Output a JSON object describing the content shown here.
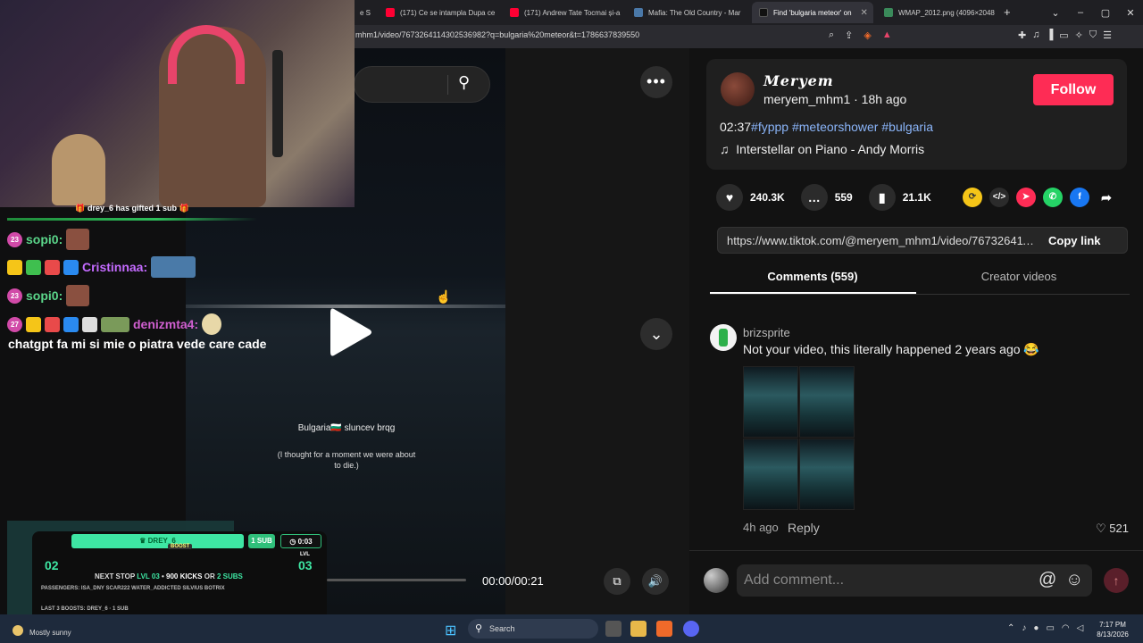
{
  "browser": {
    "tabs": [
      {
        "title": "e So",
        "icon": "tab-icon"
      },
      {
        "title": "(171) Ce se intampla Dupa ce",
        "icon": "youtube-icon"
      },
      {
        "title": "(171) Andrew Tate Tocmai și-a",
        "icon": "youtube-icon"
      },
      {
        "title": "Mafia: The Old Country - Mar",
        "icon": "steam-icon"
      },
      {
        "title": "Find 'bulgaria meteor' on",
        "icon": "tiktok-icon"
      },
      {
        "title": "WMAP_2012.png (4096×2048",
        "icon": "image-icon"
      }
    ],
    "url": "mhm1/video/7673264114302536982?q=bulgaria%20meteor&t=1786637839550",
    "new_tab": "+"
  },
  "video": {
    "search_placeholder": "",
    "caption_title": "Bulgaria🇧🇬 sluncev brqg",
    "caption_sub": "(I thought for a moment we were about to die.)",
    "time": "00:00/00:21",
    "more": "•••",
    "progress": 0
  },
  "stream": {
    "sub_banner": "drey_6 has gifted 1 sub",
    "chat": [
      {
        "badge": "23",
        "user": "sopi0:",
        "color": "#5bd68a"
      },
      {
        "badge": "",
        "user": "Cristinnaa:",
        "color": "#c46bff"
      },
      {
        "badge": "23",
        "user": "sopi0:",
        "color": "#5bd68a"
      },
      {
        "badge": "27",
        "user": "denizmta4:",
        "color": "#d05fd0"
      }
    ],
    "last_message": "chatgpt fa mi si mie o piatra vede care cade",
    "widget": {
      "top_name": "DREY_6",
      "boost": "BOOST",
      "sub_pill": "1 SUB",
      "timer": "0:03",
      "level_left": "02",
      "level_right": "03",
      "lvl_label": "LVL",
      "next_stop_prefix": "NEXT STOP ",
      "next_stop_lvl": "LVL 03",
      "next_stop_mid": " • ",
      "next_kicks": "900 KICKS",
      "next_or": " OR ",
      "next_subs": "2 SUBS",
      "passengers": "PASSENGERS:  ISA_DNY   SCAR222   WATER_ADDICTED   SILVIUS   BOTRIX",
      "last_boosts": "LAST 3 BOOSTS:   DREY_6 · 1 SUB"
    }
  },
  "post": {
    "display_name": "𝑴𝒆𝒓𝒚𝒆𝒎",
    "username_time": "meryem_mhm1 · 18h ago",
    "follow": "Follow",
    "desc_time": "02:37",
    "tags": [
      "#fyppp",
      "#meteorshower",
      "#bulgaria"
    ],
    "music": "Interstellar on Piano - Andy Morris",
    "likes": "240.3K",
    "comments": "559",
    "saves": "21.1K",
    "link": "https://www.tiktok.com/@meryem_mhm1/video/7673264114302536982...",
    "copy_link": "Copy link",
    "tab_comments": "Comments (559)",
    "tab_creator": "Creator videos"
  },
  "comment": {
    "user": "brizsprite",
    "text": "Not your video, this literally happened 2 years ago 😂",
    "time": "4h ago",
    "reply": "Reply",
    "likes": "521",
    "input_placeholder": "Add comment..."
  },
  "taskbar": {
    "weather": "Mostly sunny",
    "search": "Search",
    "time": "7:17 PM",
    "date": "8/13/2026"
  },
  "colors": {
    "follow": "#fe2c55",
    "tag": "#8ab4f8",
    "accent_green": "#3ee6a3"
  }
}
